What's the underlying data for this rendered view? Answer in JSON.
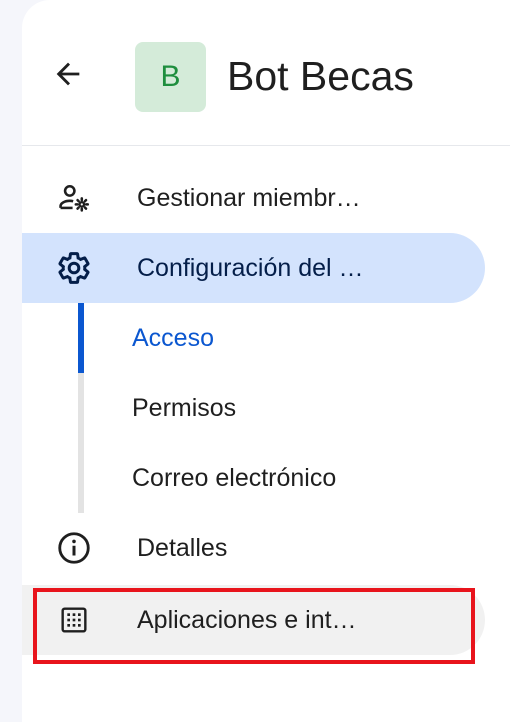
{
  "header": {
    "back_icon": "arrow-back-icon",
    "avatar_letter": "B",
    "space_name": "Bot Becas"
  },
  "nav": {
    "items": [
      {
        "label": "Gestionar miembr…",
        "icon": "manage-accounts-icon"
      },
      {
        "label": "Configuración del …",
        "icon": "settings-icon",
        "active": true
      },
      {
        "label": "Detalles",
        "icon": "info-icon"
      },
      {
        "label": "Aplicaciones e int…",
        "icon": "apps-grid-icon"
      }
    ],
    "sub_items": [
      {
        "label": "Acceso",
        "active": true
      },
      {
        "label": "Permisos"
      },
      {
        "label": "Correo electrónico"
      }
    ]
  },
  "colors": {
    "active_bg": "#d3e3fd",
    "accent_blue": "#0b57d0",
    "highlight_red": "#e8141c",
    "avatar_bg": "#d4ebd9",
    "avatar_fg": "#1e8e3e"
  }
}
